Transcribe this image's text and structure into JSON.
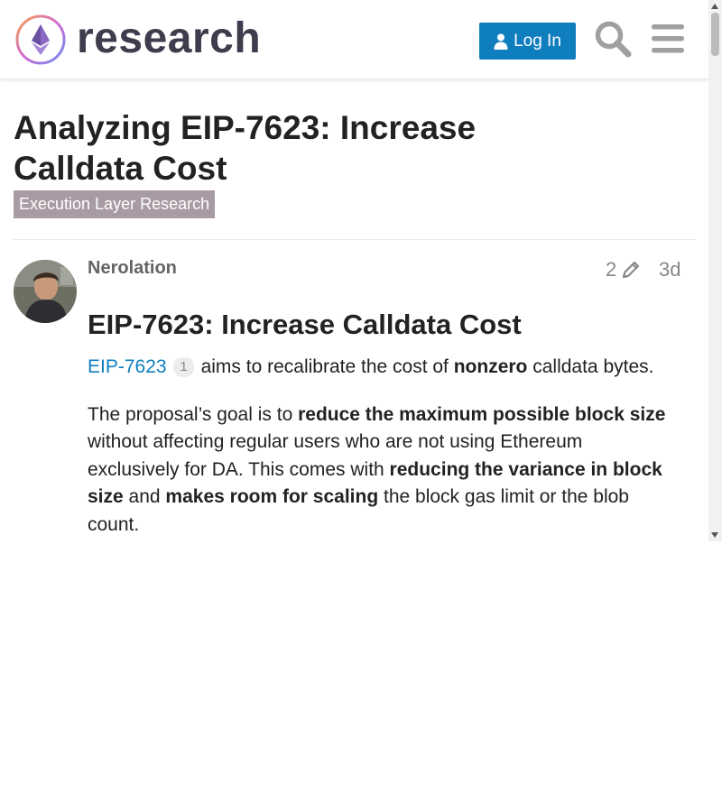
{
  "header": {
    "site_name": "research",
    "login_label": "Log In",
    "logo_icon": "ethereum-research-logo",
    "search_icon": "search-icon",
    "menu_icon": "hamburger-menu-icon",
    "login_color": "#0f7ebf"
  },
  "topic": {
    "title": "Analyzing EIP-7623: Increase Calldata Cost",
    "category": "Execution Layer Research",
    "category_color": "#a99ba3"
  },
  "post": {
    "username": "Nerolation",
    "edit_count": "2",
    "date": "3d",
    "heading": "EIP-7623: Increase Calldata Cost",
    "p1": {
      "link": "EIP-7623",
      "link_clicks": "1",
      "text_a": " aims to recalibrate the cost of ",
      "bold_a": "nonzero",
      "text_b": " calldata bytes."
    },
    "p2": {
      "text_a": "The proposal’s goal is to ",
      "bold_a": "reduce the maximum possible block size",
      "text_b": " without affecting regular users who are not using Ethereum exclusively for DA. This comes with ",
      "bold_b": "reducing the variance in block size",
      "text_c": " and ",
      "bold_c": "makes room for scaling",
      "text_d": " the block gas limit or the blob count."
    }
  }
}
